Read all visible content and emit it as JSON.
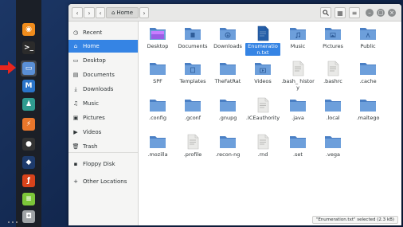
{
  "window": {
    "path_label": "Home",
    "buttons": {
      "back": "‹",
      "forward": "›",
      "prev_path": "‹",
      "next_path": "›",
      "search": "⌕",
      "view": "▦",
      "menu": "≡",
      "minimize": "–",
      "maximize": "▢",
      "close": "×"
    }
  },
  "sidebar": {
    "items": [
      {
        "label": "Recent",
        "icon": "clock-icon",
        "glyph": "◷",
        "selected": false
      },
      {
        "label": "Home",
        "icon": "home-icon",
        "glyph": "⌂",
        "selected": true
      },
      {
        "label": "Desktop",
        "icon": "desktop-icon",
        "glyph": "▭",
        "selected": false
      },
      {
        "label": "Documents",
        "icon": "documents-icon",
        "glyph": "▤",
        "selected": false
      },
      {
        "label": "Downloads",
        "icon": "download-icon",
        "glyph": "⤓",
        "selected": false
      },
      {
        "label": "Music",
        "icon": "music-icon",
        "glyph": "♫",
        "selected": false
      },
      {
        "label": "Pictures",
        "icon": "pictures-icon",
        "glyph": "▣",
        "selected": false
      },
      {
        "label": "Videos",
        "icon": "videos-icon",
        "glyph": "▶",
        "selected": false
      },
      {
        "label": "Trash",
        "icon": "trash-icon",
        "glyph": "🗑",
        "selected": false
      },
      {
        "label": "Floppy Disk",
        "icon": "floppy-icon",
        "glyph": "▪",
        "selected": false
      },
      {
        "label": "Other Locations",
        "icon": "plus-icon",
        "glyph": "+",
        "selected": false
      }
    ]
  },
  "files": [
    {
      "name": "Desktop",
      "kind": "folder-desktop"
    },
    {
      "name": "Documents",
      "kind": "folder-documents"
    },
    {
      "name": "Downloads",
      "kind": "folder-downloads"
    },
    {
      "name": "Enumeration.txt",
      "display": "Enumeratio n.txt",
      "kind": "text-file-blue",
      "selected": true
    },
    {
      "name": "Music",
      "kind": "folder-music"
    },
    {
      "name": "Pictures",
      "kind": "folder-pictures"
    },
    {
      "name": "Public",
      "kind": "folder-public"
    },
    {
      "name": "SPF",
      "kind": "folder"
    },
    {
      "name": "Templates",
      "kind": "folder-templates"
    },
    {
      "name": "TheFatRat",
      "kind": "folder"
    },
    {
      "name": "Videos",
      "kind": "folder-videos"
    },
    {
      "name": ".bash_history",
      "display": ".bash_ history",
      "kind": "text-file"
    },
    {
      "name": ".bashrc",
      "kind": "text-file"
    },
    {
      "name": ".cache",
      "kind": "folder"
    },
    {
      "name": ".config",
      "kind": "folder"
    },
    {
      "name": ".gconf",
      "kind": "folder"
    },
    {
      "name": ".gnupg",
      "kind": "folder"
    },
    {
      "name": ".ICEauthority",
      "kind": "text-file"
    },
    {
      "name": ".java",
      "kind": "folder"
    },
    {
      "name": ".local",
      "kind": "folder"
    },
    {
      "name": ".maltego",
      "kind": "folder"
    },
    {
      "name": ".mozilla",
      "kind": "folder"
    },
    {
      "name": ".profile",
      "kind": "text-file"
    },
    {
      "name": ".recon-ng",
      "kind": "folder"
    },
    {
      "name": ".rnd",
      "kind": "text-file"
    },
    {
      "name": ".set",
      "kind": "folder"
    },
    {
      "name": ".vega",
      "kind": "folder"
    }
  ],
  "status": "\"Enumeration.txt\" selected  (2.3 kB)",
  "dock": [
    {
      "name": "firefox-icon",
      "glyph": "◉",
      "color": "#f08c1c"
    },
    {
      "name": "terminal-icon",
      "glyph": ">_",
      "color": "#2b2b2b"
    },
    {
      "name": "files-icon",
      "glyph": "▭",
      "color": "#5a8fd6",
      "active": true
    },
    {
      "name": "metasploit-icon",
      "glyph": "M",
      "color": "#2a74c9"
    },
    {
      "name": "armitage-icon",
      "glyph": "♟",
      "color": "#2f9b8f"
    },
    {
      "name": "burpsuite-icon",
      "glyph": "⚡",
      "color": "#e9762b"
    },
    {
      "name": "faraday-icon",
      "glyph": "●",
      "color": "#333"
    },
    {
      "name": "beef-icon",
      "glyph": "◆",
      "color": "#1e3b6c"
    },
    {
      "name": "maltego-icon",
      "glyph": "ƒ",
      "color": "#d8431b"
    },
    {
      "name": "leafpad-icon",
      "glyph": "≡",
      "color": "#7cc639"
    },
    {
      "name": "gimp-icon",
      "glyph": "◘",
      "color": "#9fa3a6"
    }
  ],
  "colors": {
    "accent": "#3584e4",
    "folder": "#6d9fdb",
    "folder_dark": "#4a7fc4"
  }
}
